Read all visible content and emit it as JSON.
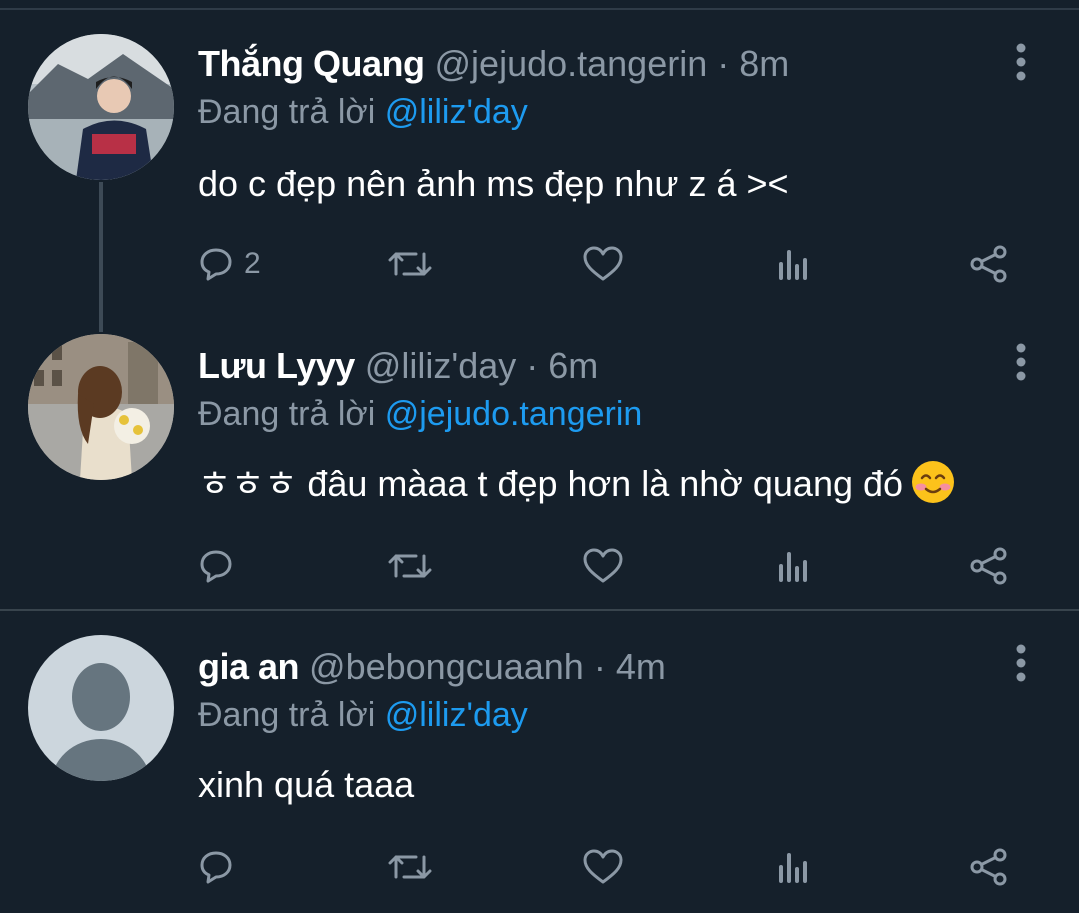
{
  "tweets": [
    {
      "name": "Thắng Quang",
      "handle": "@jejudo.tangerin",
      "separator": "·",
      "time": "8m",
      "reply_prefix": "Đang trả lời",
      "reply_to": "@liliz'day",
      "text": "do c đẹp nên ảnh ms đẹp như z á ><",
      "reply_count": "2"
    },
    {
      "name": "Lưu Lyyy",
      "handle": "@liliz'day",
      "separator": "·",
      "time": "6m",
      "reply_prefix": "Đang trả lời",
      "reply_to": "@jejudo.tangerin",
      "text": "ㅎㅎㅎ đâu màaa t đẹp hơn là nhờ quang đó",
      "emoji": "smiling-face-with-blush",
      "reply_count": ""
    },
    {
      "name": "gia an",
      "handle": "@bebongcuaanh",
      "separator": "·",
      "time": "4m",
      "reply_prefix": "Đang trả lời",
      "reply_to": "@liliz'day",
      "text": "xinh quá taaa",
      "reply_count": ""
    }
  ],
  "icons": [
    "reply-icon",
    "retweet-icon",
    "like-icon",
    "analytics-icon",
    "share-icon",
    "more-options-icon"
  ],
  "colors": {
    "background": "#15202b",
    "text": "#ffffff",
    "muted": "#8b98a5",
    "mention": "#1d9bf0",
    "divider": "#38444d"
  }
}
